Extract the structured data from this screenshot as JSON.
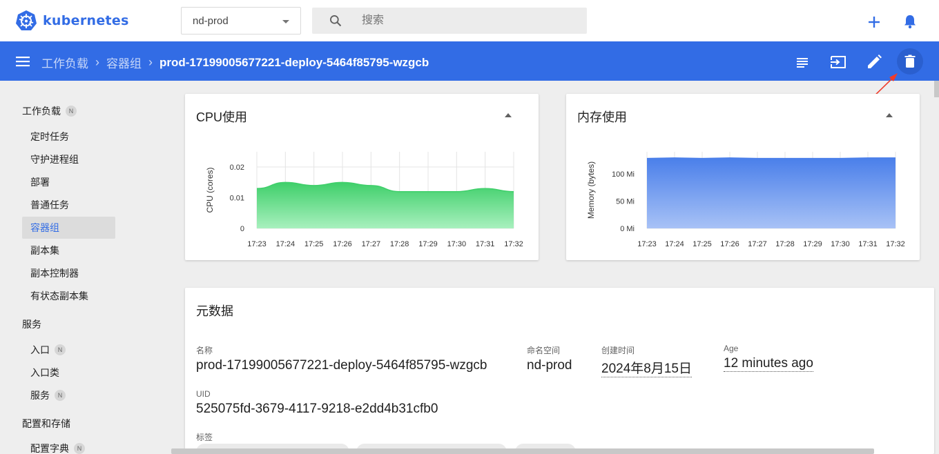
{
  "header": {
    "logo_text": "kubernetes",
    "namespace": "nd-prod",
    "search_placeholder": "搜索"
  },
  "actionbar": {
    "breadcrumbs": [
      "工作负载",
      "容器组"
    ],
    "current": "prod-17199005677221-deploy-5464f85795-wzgcb",
    "actions": [
      "logs-icon",
      "exec-icon",
      "edit-icon",
      "delete-icon"
    ]
  },
  "sidebar": {
    "workloads": {
      "label": "工作负载",
      "badge": "N"
    },
    "workload_items": [
      "定时任务",
      "守护进程组",
      "部署",
      "普通任务",
      "容器组",
      "副本集",
      "副本控制器",
      "有状态副本集"
    ],
    "active_item": "容器组",
    "service": {
      "label": "服务"
    },
    "service_items": [
      {
        "label": "入口",
        "badge": "N"
      },
      {
        "label": "入口类",
        "badge": ""
      },
      {
        "label": "服务",
        "badge": "N"
      }
    ],
    "config": {
      "label": "配置和存储"
    },
    "config_items": [
      {
        "label": "配置字典",
        "badge": "N"
      }
    ]
  },
  "cpu_card": {
    "title": "CPU使用"
  },
  "memory_card": {
    "title": "内存使用"
  },
  "chart_data": [
    {
      "type": "area",
      "title": "CPU使用",
      "ylabel": "CPU (cores)",
      "xlabel": "",
      "x": [
        "17:23",
        "17:24",
        "17:25",
        "17:26",
        "17:27",
        "17:28",
        "17:29",
        "17:30",
        "17:31",
        "17:32"
      ],
      "values": [
        0.013,
        0.015,
        0.014,
        0.015,
        0.014,
        0.012,
        0.012,
        0.012,
        0.013,
        0.012
      ],
      "yticks": [
        "0",
        "0.01",
        "0.02"
      ],
      "ylim": [
        0,
        0.025
      ],
      "color": "#4fd47a",
      "grid": true
    },
    {
      "type": "area",
      "title": "内存使用",
      "ylabel": "Memory (bytes)",
      "xlabel": "",
      "x": [
        "17:23",
        "17:24",
        "17:25",
        "17:26",
        "17:27",
        "17:28",
        "17:29",
        "17:30",
        "17:31",
        "17:32"
      ],
      "values": [
        137,
        138,
        137,
        138,
        137,
        137,
        137,
        137,
        138,
        138
      ],
      "yticks": [
        "0 Mi",
        "50 Mi",
        "100 Mi"
      ],
      "ylim": [
        0,
        150
      ],
      "color": "#5b8ef0",
      "grid": true
    }
  ],
  "metadata": {
    "title": "元数据",
    "name_label": "名称",
    "name_value": "prod-17199005677221-deploy-5464f85795-wzgcb",
    "namespace_label": "命名空间",
    "namespace_value": "nd-prod",
    "created_label": "创建时间",
    "created_value": "2024年8月15日",
    "age_label": "Age",
    "age_value": "12 minutes ago",
    "uid_label": "UID",
    "uid_value": "525075fd-3679-4117-9218-e2dd4b31cfb0",
    "labels_label": "标签"
  },
  "colors": {
    "brand": "#326ce5",
    "annotation": "#f03b2a"
  }
}
